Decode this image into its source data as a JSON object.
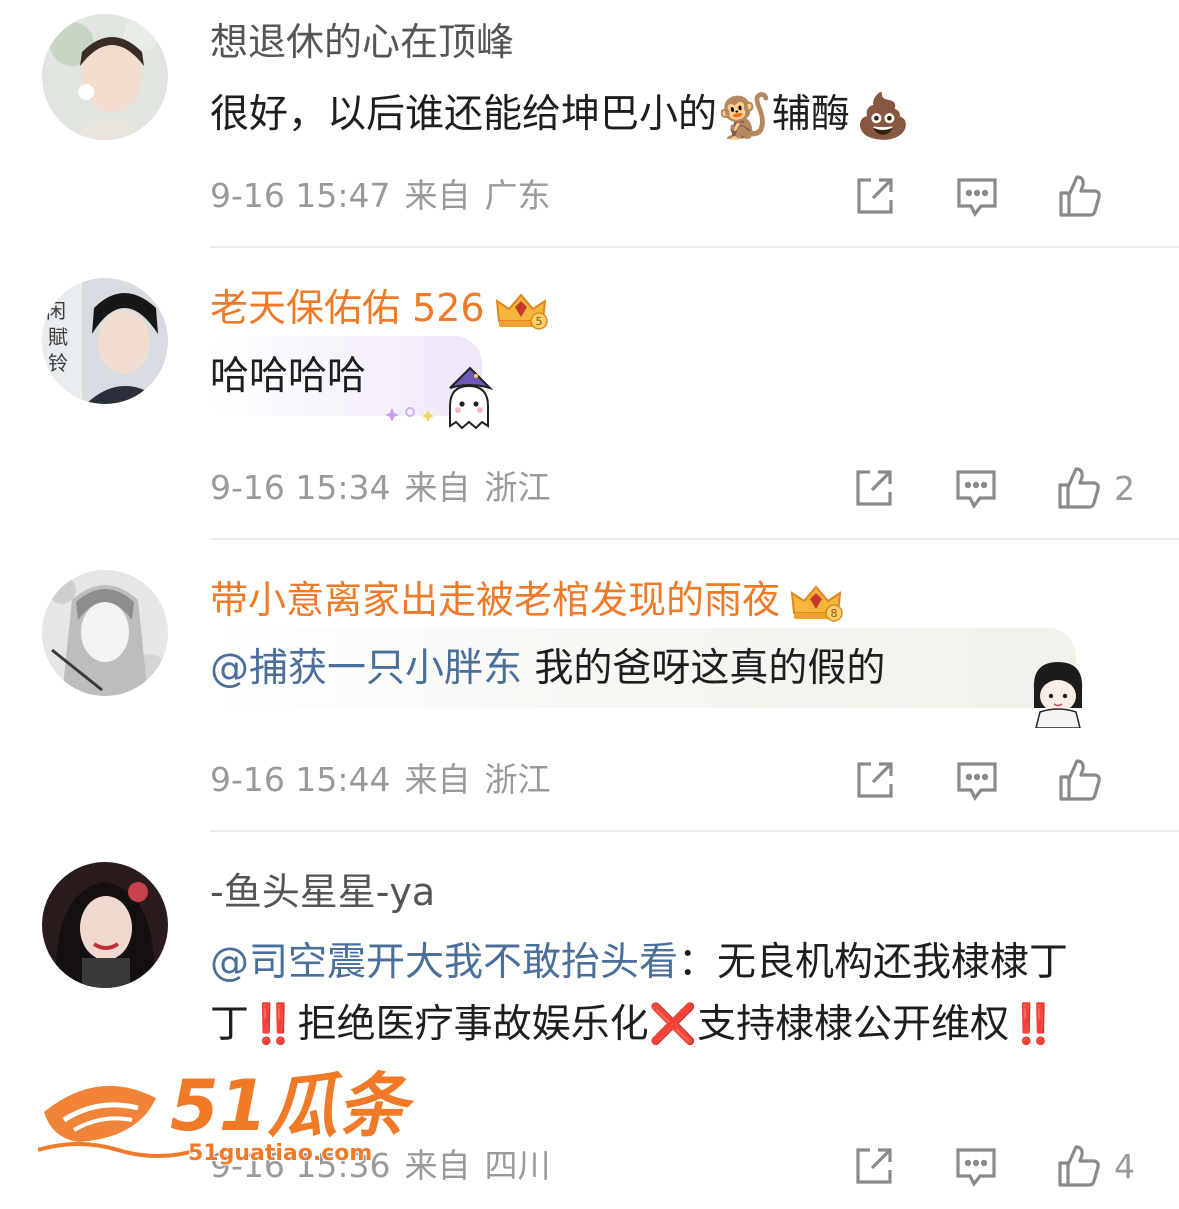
{
  "comments": [
    {
      "username": "想退休的心在顶峰",
      "text": "很好，以后谁还能给坤巴小的",
      "text_tail": "辅酶",
      "emoji1": "🐒",
      "emoji2": "💩",
      "time": "9-16 15:47",
      "from": "来自",
      "location": "广东",
      "likes": ""
    },
    {
      "username": "老天保佑佑 526",
      "vip": true,
      "text": "哈哈哈哈",
      "time": "9-16 15:34",
      "from": "来自",
      "location": "浙江",
      "likes": "2"
    },
    {
      "username": "带小意离家出走被老棺发现的雨夜",
      "vip": true,
      "mention": "@捕获一只小胖东",
      "text": " 我的爸呀这真的假的",
      "time": "9-16 15:44",
      "from": "来自",
      "location": "浙江",
      "likes": ""
    },
    {
      "username": "-鱼头星星-ya",
      "mention": "@司空震开大我不敢抬头看",
      "text_a": "：无良机构还我棣棣丁丁",
      "emoji_excl": "‼️",
      "text_b": "拒绝医疗事故娱乐化",
      "emoji_cross": "❌",
      "text_c": "支持棣棣公开维权",
      "emoji_excl2": "‼️",
      "time": "9-16 15:36",
      "from": "来自",
      "location": "四川",
      "likes": "4"
    }
  ],
  "watermark": {
    "brand": "51瓜条",
    "url": "51guatiao.com",
    "color": "#f07a27"
  },
  "icons": [
    "share-icon",
    "comment-icon",
    "like-icon",
    "crown-badge-icon"
  ],
  "colors": {
    "vip_name": "#f07a27",
    "mention": "#4a6f9a",
    "meta": "#9a9a9a",
    "divider": "#ececec"
  }
}
